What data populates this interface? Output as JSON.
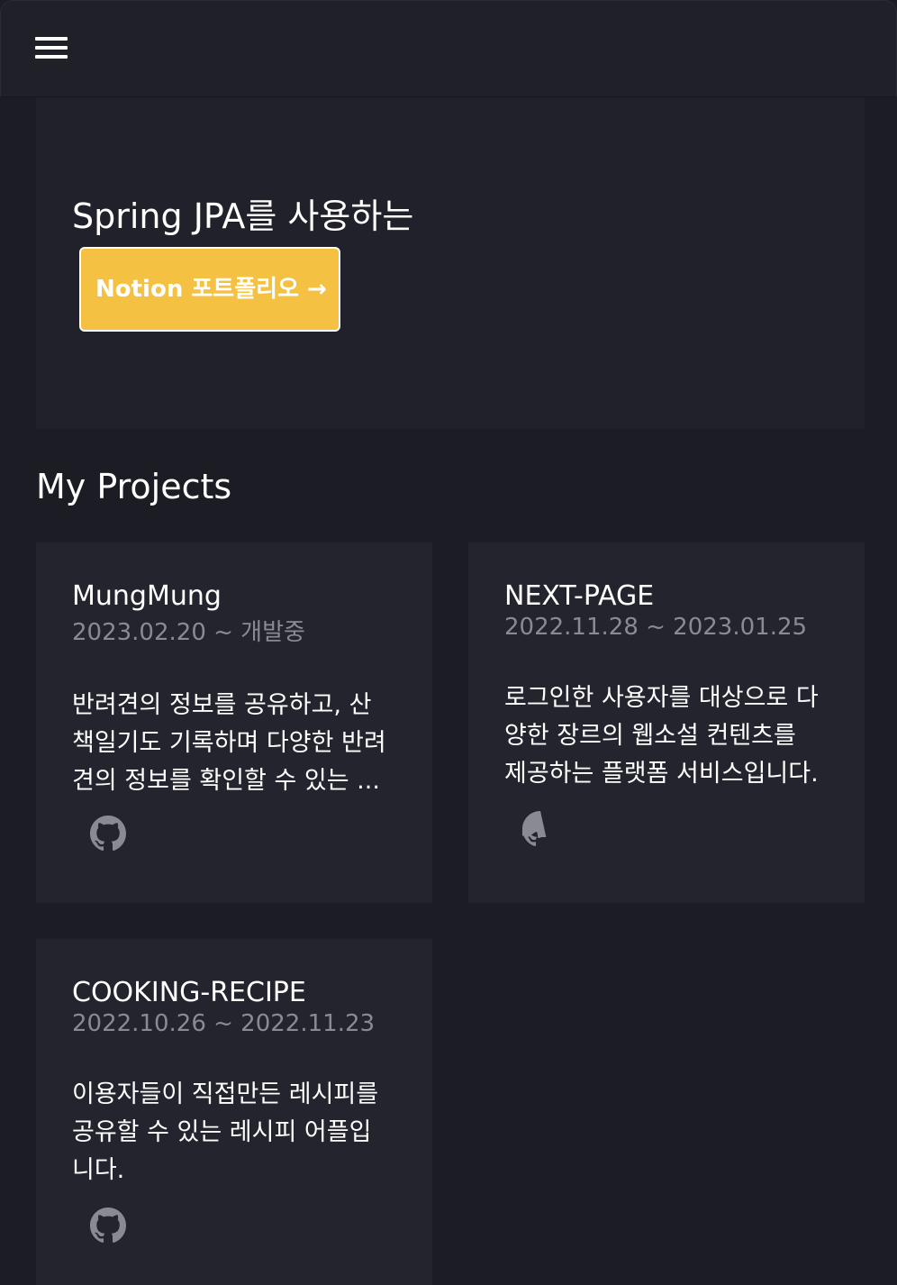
{
  "header": {
    "menu_icon": "hamburger-menu-icon"
  },
  "hero": {
    "title": "Spring JPA를 사용하는",
    "button_label": "Notion 포트폴리오 →",
    "button_color": "#f4c143"
  },
  "projects": {
    "heading": "My Projects",
    "items": [
      {
        "title": "MungMung",
        "date": "2023.02.20 ~ 개발중",
        "desc_lines": [
          "반려견의 정보를 공유하고, 산",
          "책일기도 기록하며 다양한 반려",
          "견의 정보를 확인할 수 있는 ..."
        ],
        "icon": "github-icon"
      },
      {
        "title": "NEXT-PAGE",
        "date": "2022.11.28 ~ 2023.01.25",
        "desc_lines": [
          "로그인한 사용자를 대상으로 다",
          "양한 장르의 웹소설 컨텐츠를",
          "제공하는 플랫폼 서비스입니다."
        ],
        "icon": "github-icon"
      },
      {
        "title": "COOKING-RECIPE",
        "date": "2022.10.26 ~ 2022.11.23",
        "desc_lines": [
          "이용자들이 직접만든 레시피를",
          "공유할 수 있는 레시피 어플입",
          "니다."
        ],
        "icon": "github-icon"
      }
    ]
  },
  "colors": {
    "background": "#1c1d24",
    "card": "#23242e",
    "muted_text": "#8a8b92",
    "accent": "#f4c143"
  }
}
